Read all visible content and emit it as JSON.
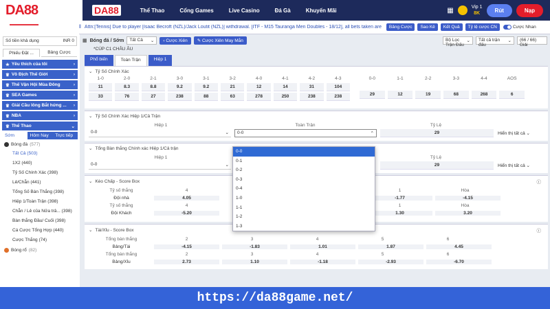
{
  "header": {
    "logo": "DA88",
    "logo2": "DA88",
    "nav": [
      "Thể Thao",
      "Cổng Games",
      "Live Casino",
      "Đá Gà",
      "Khuyến Mãi"
    ],
    "vip_label": "Vip 1",
    "balance": "8K",
    "btn_withdraw": "Rút",
    "btn_deposit": "Nạp"
  },
  "subbar": {
    "ticker": "Attn:[Tennis] Due to player [Isaac Becroft (NZL)/Jack Loutit (NZL)] withdrawal. [ITF - M15 Tauranga Men Doubles - 18/12], all bets taken are",
    "buttons": [
      "Bảng Cược",
      "Sao Kê",
      "Kết Quả",
      "Tỷ lệ cược CN"
    ],
    "toggle_label": "Cược Nhan"
  },
  "sidebar": {
    "search_placeholder": "Số tiền khả dụng",
    "search_value": "INR 0",
    "tabs": [
      "Phiếu Đặt ...",
      "Bảng Cược"
    ],
    "categories": [
      "Yêu thích của tôi",
      "Vô Địch Thế Giới",
      "Thế Vận Hội Mùa Đông",
      "SEA Games",
      "Giải Cầu lông Bắt hứng ...",
      "NBA",
      "Thể Thao"
    ],
    "subtabs": [
      "Sớm",
      "Hôm Nay",
      "Trực tiếp"
    ],
    "sport_parent": "Bóng đá",
    "sport_parent_count": "(577)",
    "items": [
      "Tất Cả (503)",
      "1X2 (440)",
      "Tỷ Số Chính Xác (398)",
      "Lẻ/Chẵn (441)",
      "Tổng Số Bàn Thắng (398)",
      "Hiệp 1/Toàn Trận (398)",
      "Chẵn / Lẻ của Nửa trâ... (398)",
      "Bàn thắng Đầu/ Cuối (398)",
      "Cá Cược Tổng Hợp (440)",
      "Cược Thắng (74)"
    ],
    "next_sport": "Bóng rổ",
    "next_sport_count": "(82)"
  },
  "toolbar": {
    "sport": "Bóng đá / Sớm",
    "filter": "Tất Cả",
    "chip1": "Cược Xiên",
    "chip2": "Cược Xiên May Mắn",
    "right1": "Bộ Lọc Trận Đấu",
    "right2": "Tất cả trận đấu",
    "right3": "(66 / 66) Giải"
  },
  "cup": "*CÚP C1 CHÂU ÂU",
  "bet_tabs": [
    "Phổ biến",
    "Toàn Trận",
    "Hiệp 1"
  ],
  "exact_score": {
    "title": "Tỷ Số Chính Xác",
    "headers": [
      "1-0",
      "2-0",
      "2-1",
      "3-0",
      "3-1",
      "3-2",
      "4-0",
      "4-1",
      "4-2",
      "4-3",
      "0-0",
      "1-1",
      "2-2",
      "3-3",
      "4-4",
      "AOS"
    ],
    "row1": [
      "11",
      "8.3",
      "8.8",
      "9.2",
      "9.2",
      "21",
      "12",
      "14",
      "31",
      "104"
    ],
    "row2": [
      "33",
      "76",
      "27",
      "238",
      "88",
      "63",
      "278",
      "250",
      "238",
      "238"
    ],
    "right": [
      "29",
      "12",
      "19",
      "68",
      "268",
      "6"
    ]
  },
  "ht_exact": {
    "title": "Tỷ Số Chính Xác Hiệp 1/Cả Trận",
    "h1": "Hiệp 1",
    "full": "Toàn Trận",
    "odds": "Tỷ Lệ",
    "sel1": "0-0",
    "sel2": "0-0",
    "value": "29",
    "show_all": "Hiển thị tất cả"
  },
  "total_goals": {
    "title": "Tổng Bàn thắng Chính xác Hiệp 1/Cả trận",
    "h1": "Hiệp 1",
    "odds": "Tỷ Lệ",
    "sel1": "0-0",
    "value": "29",
    "show_all": "Hiển thị tất cả"
  },
  "dropdown": [
    "0-0",
    "0-1",
    "0-2",
    "0-3",
    "0-4",
    "1-0",
    "1-1",
    "1-2",
    "1-3"
  ],
  "handicap": {
    "title": "Kèo Chấp - Score Box",
    "rows": [
      {
        "label": "Tỷ số thắng",
        "h": "4",
        "mid": "1",
        "right": "Hòa"
      },
      {
        "label": "Đội nhà",
        "v": "4.05",
        "m": "-1.77",
        "r": "-4.15"
      },
      {
        "label": "Tỷ số thắng",
        "h": "4",
        "mid": "1",
        "right": "Hòa"
      },
      {
        "label": "Đội Khách",
        "v": "-5.20",
        "m": "1.30",
        "r": "3.20"
      }
    ]
  },
  "overunder": {
    "title": "Tài/Xỉu - Score Box",
    "rows": [
      {
        "label": "Tổng bàn thắng",
        "c": [
          "2",
          "3",
          "4",
          "5",
          "6"
        ]
      },
      {
        "label": "Bảng/Tài",
        "c": [
          "-4.15",
          "-1.83",
          "1.01",
          "1.87",
          "4.45"
        ]
      },
      {
        "label": "Tổng bàn thắng",
        "c": [
          "2",
          "3",
          "4",
          "5",
          "6"
        ]
      },
      {
        "label": "Bảng/Xỉu",
        "c": [
          "2.73",
          "1.10",
          "-1.18",
          "-2.93",
          "-6.70"
        ]
      }
    ]
  },
  "footer": "https://da88game.net/"
}
